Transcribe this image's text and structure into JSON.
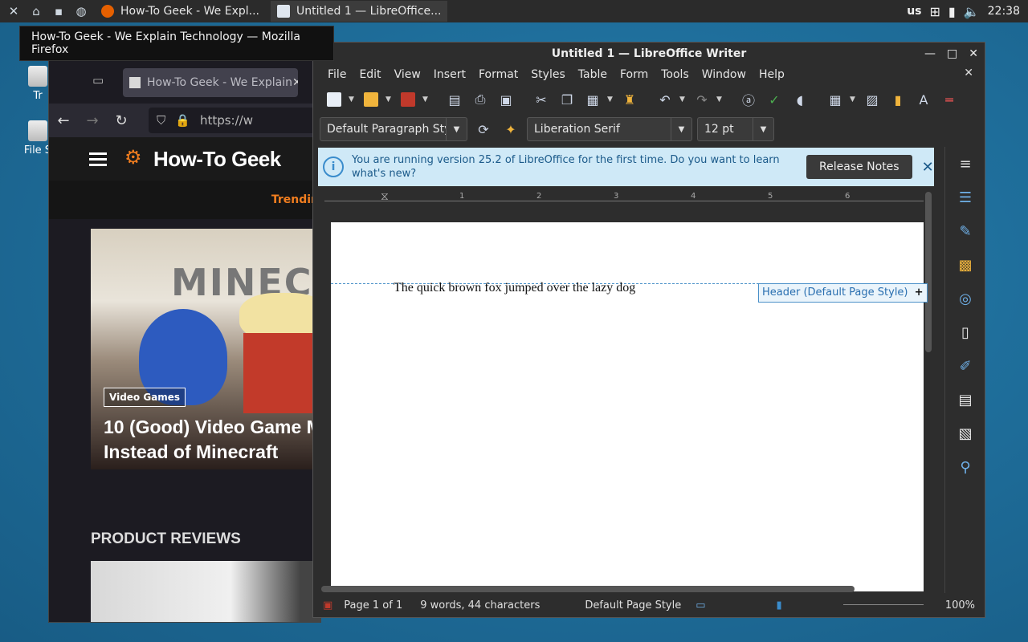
{
  "taskbar": {
    "tasks": [
      {
        "label": "How-To Geek - We Expl..."
      },
      {
        "label": "Untitled 1 — LibreOffice..."
      }
    ],
    "keyboard_layout": "us",
    "clock": "22:38"
  },
  "desktop": {
    "icons": [
      {
        "label": "Tr"
      },
      {
        "label": "File S"
      }
    ]
  },
  "tooltip": {
    "text": "How-To Geek - We Explain Technology — Mozilla Firefox"
  },
  "firefox": {
    "tab_title": "How-To Geek - We Explain",
    "url": "https://w",
    "site": {
      "logo_text": "How-To Geek",
      "trending": "Trendin",
      "feature_badge": "Video Games",
      "feature_title": "10 (Good) Video Game M Instead of Minecraft",
      "section_title": "PRODUCT REVIEWS"
    }
  },
  "writer": {
    "title": "Untitled 1 — LibreOffice Writer",
    "menu": [
      "File",
      "Edit",
      "View",
      "Insert",
      "Format",
      "Styles",
      "Table",
      "Form",
      "Tools",
      "Window",
      "Help"
    ],
    "paragraph_style": "Default Paragraph Sty",
    "font_name": "Liberation Serif",
    "font_size": "12 pt",
    "infobar": {
      "message": "You are running version 25.2 of LibreOffice for the first time. Do you want to learn what's new?",
      "button": "Release Notes"
    },
    "ruler_numbers": [
      "1",
      "2",
      "3",
      "4",
      "5",
      "6"
    ],
    "document_text": "The quick brown fox jumped over the lazy dog",
    "header_tag": "Header (Default Page Style)",
    "status": {
      "page": "Page 1 of 1",
      "words": "9 words, 44 characters",
      "page_style": "Default Page Style",
      "zoom": "100%"
    }
  },
  "colors": {
    "accent": "#f07d1f",
    "infobar_bg": "#cfe9f7",
    "desktop_bg": "#1f6f9c"
  }
}
